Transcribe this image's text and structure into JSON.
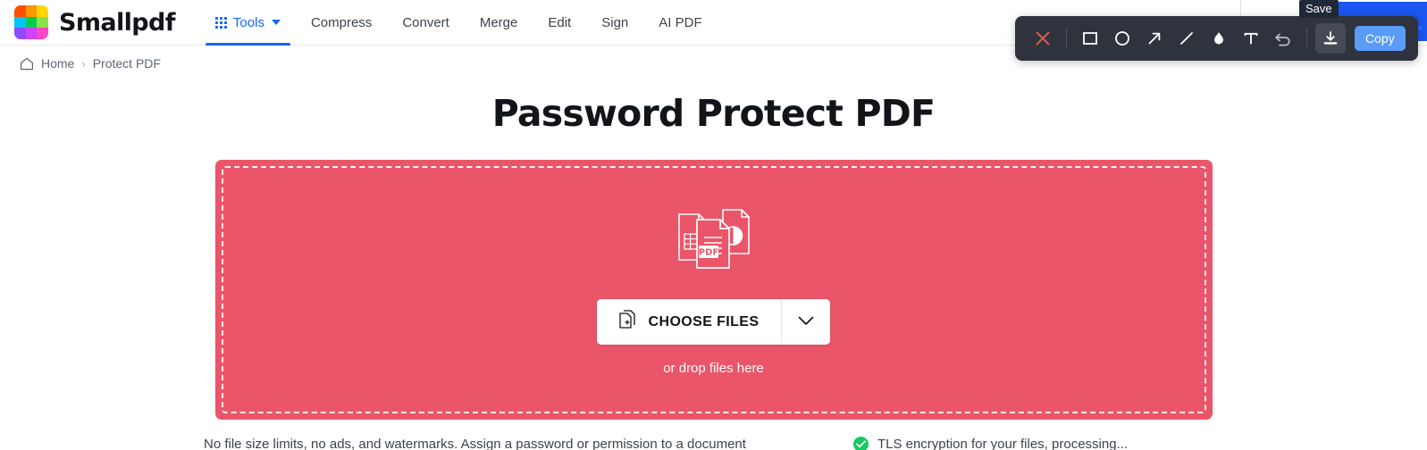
{
  "brand": {
    "name": "Smallpdf",
    "logo_colors": [
      "#ff4d00",
      "#ff9500",
      "#ffd400",
      "#00c2ff",
      "#00cc55",
      "#8ee04a",
      "#8c4bff",
      "#cc44ff",
      "#ff44c8"
    ]
  },
  "nav": {
    "items": [
      {
        "label": "Tools",
        "icon": "grid-dots-icon",
        "active": true,
        "has_caret": true
      },
      {
        "label": "Compress",
        "active": false
      },
      {
        "label": "Convert",
        "active": false
      },
      {
        "label": "Merge",
        "active": false
      },
      {
        "label": "Edit",
        "active": false
      },
      {
        "label": "Sign",
        "active": false
      },
      {
        "label": "AI PDF",
        "active": false
      }
    ]
  },
  "breadcrumb": {
    "home": "Home",
    "separator": "›",
    "current": "Protect PDF"
  },
  "main": {
    "title": "Password Protect PDF",
    "dropzone": {
      "choose_files_label": "CHOOSE FILES",
      "drop_hint": "or drop files here",
      "background_color": "#eb5569",
      "illustration": "pdf-documents-icon"
    },
    "info": [
      {
        "text": "No file size limits, no ads, and watermarks. Assign a password or permission to a document",
        "icon": null
      },
      {
        "text": "TLS encryption for your files, processing...",
        "icon": "green-check-icon"
      }
    ]
  },
  "annotation_toolbar": {
    "tools": [
      {
        "name": "close-icon",
        "label": "Close",
        "color": "#e2584a",
        "active": false
      },
      {
        "name": "rectangle-icon",
        "label": "Rectangle",
        "active": false
      },
      {
        "name": "ellipse-icon",
        "label": "Ellipse",
        "active": false
      },
      {
        "name": "arrow-icon",
        "label": "Arrow",
        "active": false
      },
      {
        "name": "line-icon",
        "label": "Line",
        "active": false
      },
      {
        "name": "blur-drop-icon",
        "label": "Blur",
        "active": false
      },
      {
        "name": "text-icon",
        "label": "Text",
        "active": false
      },
      {
        "name": "undo-icon",
        "label": "Undo",
        "active": false
      },
      {
        "name": "download-icon",
        "label": "Save",
        "active": true
      }
    ],
    "copy_label": "Copy",
    "tooltip": "Save",
    "background_color": "#2f333d",
    "copy_color": "#5b9cf8"
  }
}
